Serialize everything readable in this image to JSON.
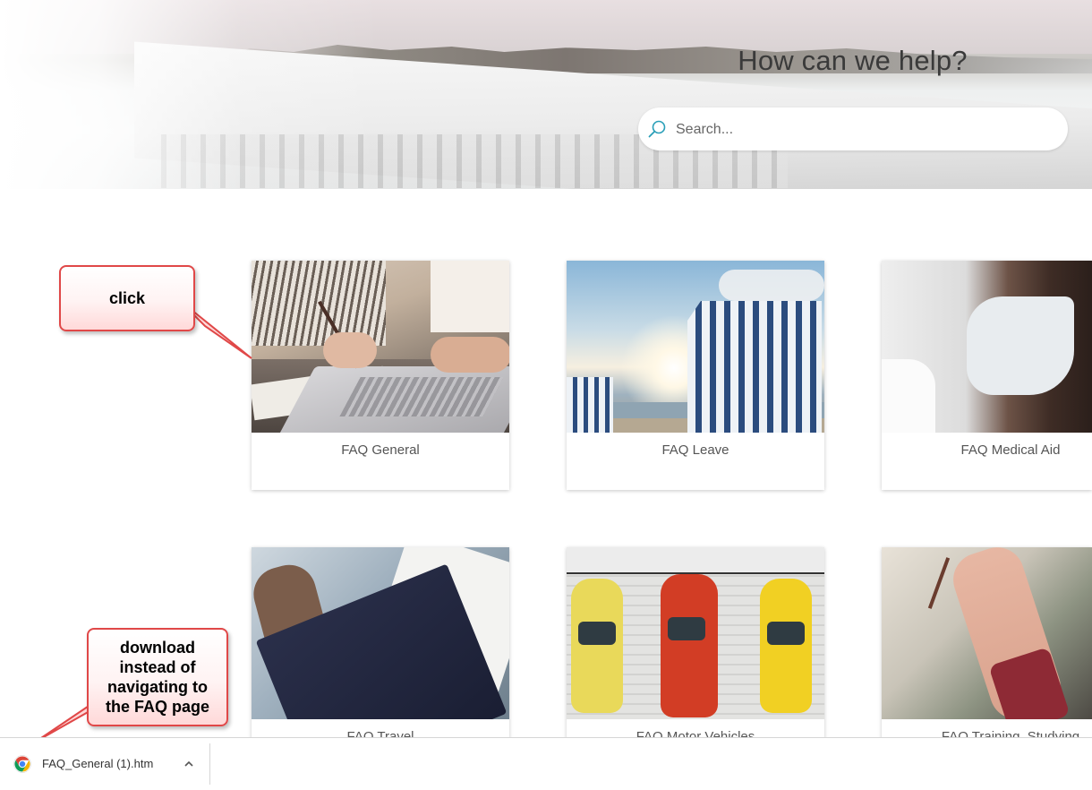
{
  "hero": {
    "title": "How can we help?",
    "search_placeholder": "Search..."
  },
  "cards": [
    {
      "label": "FAQ General"
    },
    {
      "label": "FAQ Leave"
    },
    {
      "label": "FAQ Medical Aid"
    },
    {
      "label": "FAQ Travel"
    },
    {
      "label": "FAQ Motor Vehicles"
    },
    {
      "label": "FAQ Training, Studying"
    }
  ],
  "annotations": {
    "click": "click",
    "download_lines": [
      "download",
      "instead of",
      "navigating to",
      "the FAQ page"
    ]
  },
  "download_bar": {
    "filename": "FAQ_General (1).htm",
    "file_icon": "chrome-icon",
    "chevron_icon": "chevron-up-icon"
  },
  "colors": {
    "callout_border": "#e04848",
    "search_icon": "#2a9fb8"
  }
}
